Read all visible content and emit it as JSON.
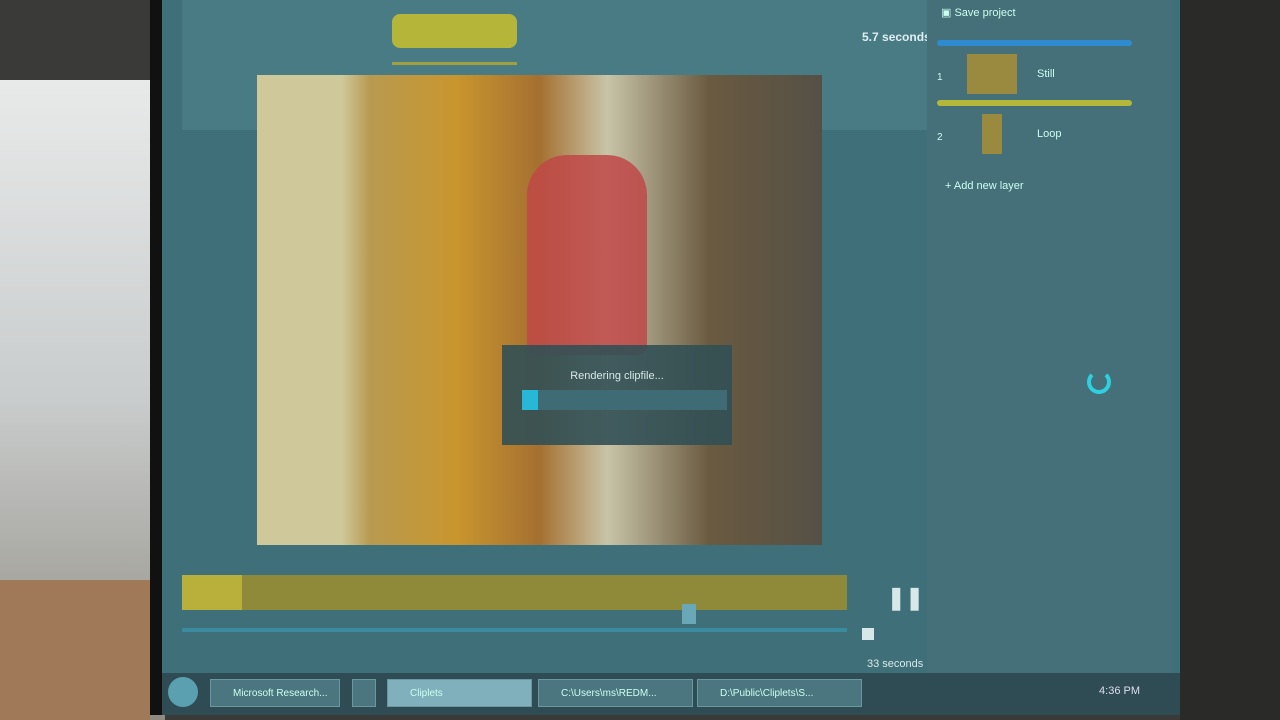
{
  "header": {
    "duration": "5.7 seconds"
  },
  "sidebar": {
    "save_label": "Save project",
    "layers": [
      {
        "index": "1",
        "label": "Still",
        "color": "#2e8bd0"
      },
      {
        "index": "2",
        "label": "Loop",
        "color": "#b4b83a"
      }
    ],
    "add_layer": "+ Add new layer"
  },
  "dialog": {
    "message": "Rendering clipfile...",
    "progress": 0.08
  },
  "timeline": {
    "total": "33 seconds",
    "pause_icon": "pause-icon"
  },
  "taskbar": {
    "items": [
      "Microsoft Research...",
      "",
      "Cliplets",
      "C:\\Users\\ms\\REDM...",
      "D:\\Public\\Cliplets\\S..."
    ],
    "clock": "4:36 PM"
  }
}
